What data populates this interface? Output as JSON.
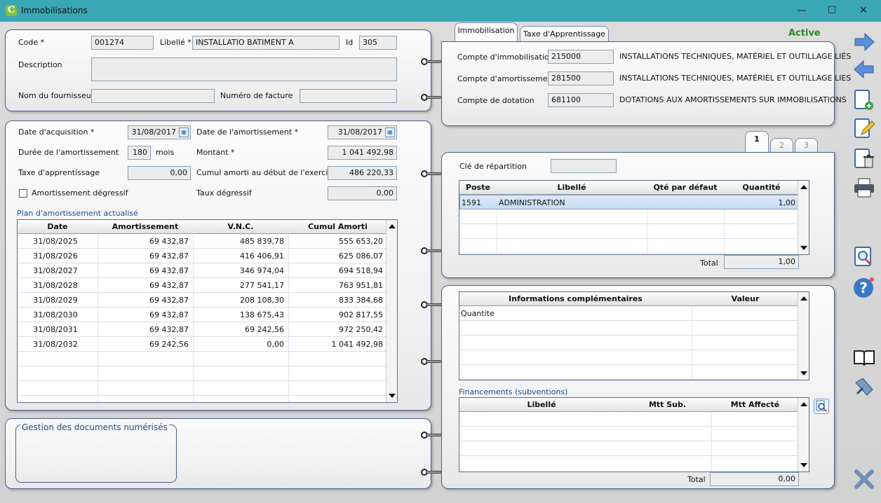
{
  "window": {
    "title": "Immobilisations",
    "app_icon": "C",
    "minimize": "—",
    "maximize": "☐",
    "close": "✕"
  },
  "status": {
    "label": "Active",
    "color": "#2a8a2a"
  },
  "ident": {
    "code_label": "Code *",
    "code": "001274",
    "libelle_label": "Libellé *",
    "libelle": "INSTALLATIO BATIMENT A",
    "id_label": "Id",
    "id": "305",
    "description_label": "Description",
    "description": "",
    "fournisseur_label": "Nom du fournisseur",
    "fournisseur": "",
    "facture_label": "Numéro de facture",
    "facture": ""
  },
  "amort": {
    "date_acq_label": "Date d'acquisition *",
    "date_acq": "31/08/2017",
    "date_amort_label": "Date de l'amortissement *",
    "date_amort": "31/08/2017",
    "duree_label": "Durée de l'amortissement",
    "duree": "180",
    "duree_unit": "mois",
    "montant_label": "Montant *",
    "montant": "1 041 492,98",
    "taxe_label": "Taxe d'apprentissage",
    "taxe": "0,00",
    "cumul_label": "Cumul amorti au début de l'exercice",
    "cumul": "486 220,33",
    "degressif_label": "Amortissement dégressif",
    "degressif_checked": false,
    "taux_label": "Taux dégressif",
    "taux": "0,00"
  },
  "plan": {
    "title": "Plan d'amortissement actualisé",
    "columns": [
      "Date",
      "Amortissement",
      "V.N.C.",
      "Cumul Amorti"
    ],
    "rows": [
      [
        "31/08/2025",
        "69 432,87",
        "485 839,78",
        "555 653,20"
      ],
      [
        "31/08/2026",
        "69 432,87",
        "416 406,91",
        "625 086,07"
      ],
      [
        "31/08/2027",
        "69 432,87",
        "346 974,04",
        "694 518,94"
      ],
      [
        "31/08/2028",
        "69 432,87",
        "277 541,17",
        "763 951,81"
      ],
      [
        "31/08/2029",
        "69 432,87",
        "208 108,30",
        "833 384,68"
      ],
      [
        "31/08/2030",
        "69 432,87",
        "138 675,43",
        "902 817,55"
      ],
      [
        "31/08/2031",
        "69 432,87",
        "69 242,56",
        "972 250,42"
      ],
      [
        "31/08/2032",
        "69 242,56",
        "0,00",
        "1 041 492,98"
      ]
    ]
  },
  "docs": {
    "title": "Gestion des documents numérisés"
  },
  "tabs": [
    "Immobilisation",
    "Taxe d'Apprentissage"
  ],
  "comptes": {
    "immo_label": "Compte d'immobilisation",
    "immo": "215000",
    "immo_desc": "INSTALLATIONS TECHNIQUES, MATÉRIEL ET OUTILLAGE LIÉS",
    "amort_label": "Compte d'amortissement",
    "amort": "281500",
    "amort_desc": "INSTALLATIONS TECHNIQUES, MATÉRIEL ET OUTILLAGE LIES",
    "dot_label": "Compte de dotation",
    "dot": "681100",
    "dot_desc": "DOTATIONS AUX AMORTISSEMENTS SUR IMMOBILISATIONS"
  },
  "repart": {
    "tabs": [
      "1",
      "2",
      "3"
    ],
    "cle_label": "Clé de répartition",
    "cle": "",
    "columns": [
      "Poste",
      "Libellé",
      "Qté par défaut",
      "Quantité"
    ],
    "rows": [
      [
        "1591",
        "ADMINISTRATION",
        "",
        "1,00"
      ]
    ],
    "total_label": "Total",
    "total": "1,00"
  },
  "infos": {
    "columns": [
      "Informations complémentaires",
      "Valeur"
    ],
    "rows": [
      [
        "Quantite",
        ""
      ]
    ]
  },
  "financements": {
    "title": "Financements (subventions)",
    "columns": [
      "Libellé",
      "Mtt Sub.",
      "Mtt Affecté"
    ],
    "total_label": "Total",
    "total": "0,00"
  },
  "toolbar": {
    "icons": [
      "arrow-right-icon",
      "arrow-left-icon",
      "add-document-icon",
      "edit-icon",
      "delete-icon",
      "print-icon",
      "search-icon",
      "help-icon",
      "book-icon",
      "tools-icon",
      "exit-icon"
    ]
  }
}
